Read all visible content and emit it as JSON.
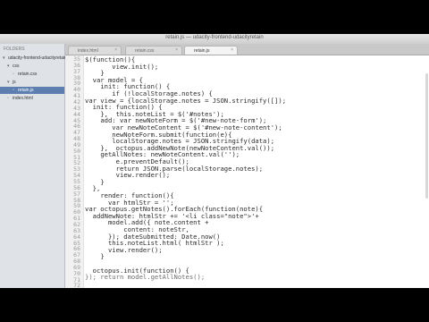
{
  "titlebar": {
    "text": "retain.js — udacity-frontend-udacityretain"
  },
  "tabs": [
    {
      "label": "index.html",
      "active": false
    },
    {
      "label": "retain.css",
      "active": false
    },
    {
      "label": "retain.js",
      "active": true
    }
  ],
  "sidebar": {
    "header": "FOLDERS",
    "items": [
      {
        "label": "udacity-frontend-udacityretain",
        "indent": 0,
        "icon": "folder-open",
        "selected": false
      },
      {
        "label": "css",
        "indent": 1,
        "icon": "folder-open",
        "selected": false
      },
      {
        "label": "retain.css",
        "indent": 2,
        "icon": "file",
        "selected": false
      },
      {
        "label": "js",
        "indent": 1,
        "icon": "folder-open",
        "selected": false
      },
      {
        "label": "retain.js",
        "indent": 2,
        "icon": "file",
        "selected": true
      },
      {
        "label": "index.html",
        "indent": 1,
        "icon": "file",
        "selected": false
      }
    ]
  },
  "gutter": {
    "line_numbers": [
      "35",
      "36",
      "37",
      "38",
      "39",
      "40",
      "41",
      "42",
      "43",
      "44",
      "45",
      "46",
      "47",
      "48",
      "49",
      "50",
      "51",
      "52",
      "53",
      "54",
      "55",
      "56",
      "57",
      "58",
      "59",
      "60",
      "61",
      "62",
      "63",
      "64",
      "65",
      "66",
      "67",
      "68",
      "69",
      "70",
      "71",
      "72",
      "73"
    ]
  },
  "code_lines": [
    {
      "text": "$(function(){",
      "indent": 0,
      "faint": false
    },
    {
      "text": "view.init();",
      "indent": 7,
      "faint": false
    },
    {
      "text": "}",
      "indent": 4,
      "faint": false
    },
    {
      "text": "var model = {",
      "indent": 2,
      "faint": false
    },
    {
      "text": "init: function() {",
      "indent": 4,
      "faint": false
    },
    {
      "text": "if (!localStorage.notes) {",
      "indent": 7,
      "faint": false
    },
    {
      "text": "var view = {localStorage.notes = JSON.stringify([]);",
      "indent": 0,
      "faint": false
    },
    {
      "text": "init: function() {",
      "indent": 2,
      "faint": false
    },
    {
      "text": "},  this.noteList = $('#notes');",
      "indent": 4,
      "faint": false
    },
    {
      "text": "add: var newNoteForm = $('#new-note-form');",
      "indent": 4,
      "faint": false
    },
    {
      "text": "var newNoteContent = $('#new-note-content');",
      "indent": 7,
      "faint": false
    },
    {
      "text": "newNoteForm.submit(function(e){",
      "indent": 7,
      "faint": false
    },
    {
      "text": "localStorage.notes = JSON.stringify(data);",
      "indent": 7,
      "faint": false
    },
    {
      "text": "},  octopus.addNewNote(newNoteContent.val());",
      "indent": 4,
      "faint": false
    },
    {
      "text": "getAllNotes: newNoteContent.val('');",
      "indent": 4,
      "faint": false
    },
    {
      "text": "e.preventDefault();",
      "indent": 8,
      "faint": false
    },
    {
      "text": "return JSON.parse(localStorage.notes);",
      "indent": 8,
      "faint": false
    },
    {
      "text": "view.render();",
      "indent": 8,
      "faint": false
    },
    {
      "text": "}",
      "indent": 4,
      "faint": false
    },
    {
      "text": "},",
      "indent": 2,
      "faint": false
    },
    {
      "text": "render: function(){",
      "indent": 4,
      "faint": false
    },
    {
      "text": "var htmlStr = '';",
      "indent": 6,
      "faint": false
    },
    {
      "text": "var octopus.getNotes().forEach(function(note){",
      "indent": 0,
      "faint": false
    },
    {
      "text": "addNewNote: htmlStr += '<li class=\"note\">'+",
      "indent": 2,
      "faint": false
    },
    {
      "text": "model.add({ note.content +",
      "indent": 6,
      "faint": false
    },
    {
      "text": "content: noteStr,",
      "indent": 10,
      "faint": false
    },
    {
      "text": "}); dateSubmitted: Date.now()",
      "indent": 6,
      "faint": false
    },
    {
      "text": "this.noteList.html( htmlStr );",
      "indent": 6,
      "faint": false
    },
    {
      "text": "view.render();",
      "indent": 6,
      "faint": false
    },
    {
      "text": "}",
      "indent": 4,
      "faint": false
    },
    {
      "text": "",
      "indent": 0,
      "faint": false
    },
    {
      "text": "octopus.init(function() {",
      "indent": 2,
      "faint": false
    },
    {
      "text": "}); return model.getAllNotes();",
      "indent": 0,
      "faint": true
    }
  ]
}
